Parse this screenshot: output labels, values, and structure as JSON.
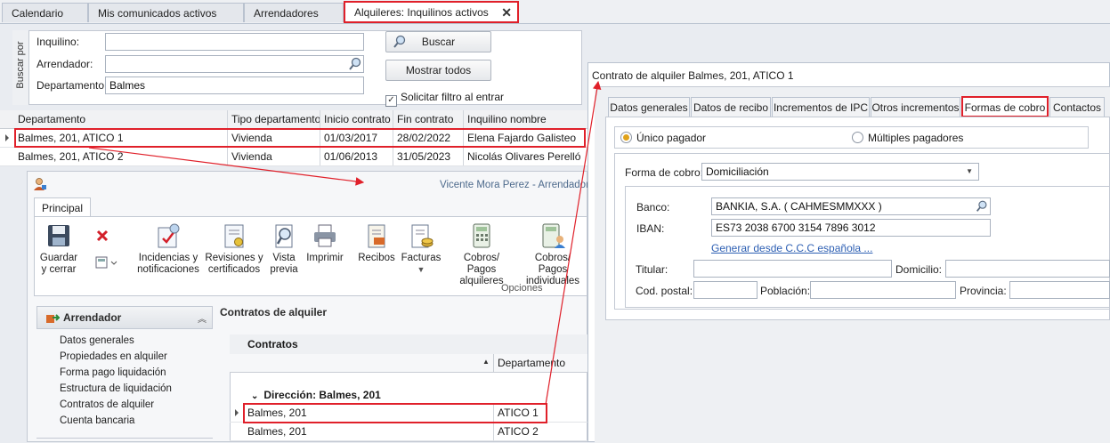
{
  "doc_tabs": [
    {
      "label": "Calendario"
    },
    {
      "label": "Mis comunicados activos"
    },
    {
      "label": "Arrendadores"
    },
    {
      "label": "Alquileres: Inquilinos activos",
      "close": "✕"
    }
  ],
  "search_panel": {
    "side_label": "Buscar por",
    "inquilino_label": "Inquilino:",
    "inquilino_value": "",
    "arrendador_label": "Arrendador:",
    "arrendador_value": "",
    "departamento_label": "Departamento:",
    "departamento_value": "Balmes",
    "buscar_label": "Buscar",
    "mostrar_todos_label": "Mostrar todos",
    "solicitar_label": "Solicitar filtro al entrar",
    "solicitar_checked": true
  },
  "tenants_grid": {
    "columns": [
      "Departamento",
      "Tipo departamento",
      "Inicio contrato",
      "Fin contrato",
      "Inquilino nombre"
    ],
    "rows": [
      [
        "Balmes, 201, ATICO 1",
        "Vivienda",
        "01/03/2017",
        "28/02/2022",
        "Elena Fajardo Galisteo"
      ],
      [
        "Balmes, 201, ATICO 2",
        "Vivienda",
        "01/06/2013",
        "31/05/2023",
        "Nicolás Olivares Perelló"
      ]
    ]
  },
  "landlord_window": {
    "title": "Vicente Mora Perez - Arrendador",
    "ribbon_tab": "Principal",
    "ribbon_buttons": {
      "guardar": "Guardar y cerrar",
      "incidencias": "Incidencias y notificaciones",
      "revisiones": "Revisiones y certificados",
      "vista": "Vista previa",
      "imprimir": "Imprimir",
      "recibos": "Recibos",
      "facturas": "Facturas",
      "cobros_alq": "Cobros/ Pagos alquileres",
      "cobros_ind": "Cobros/ Pagos individuales"
    },
    "ribbon_group": "Opciones",
    "nav_header": "Arrendador",
    "nav_items": [
      "Datos generales",
      "Propiedades en alquiler",
      "Forma pago liquidación",
      "Estructura de liquidación",
      "Contratos de alquiler",
      "Cuenta bancaria"
    ],
    "contracts_title": "Contratos de alquiler",
    "contracts_group": "Contratos",
    "dept_col": "Departamento",
    "group_row": "Dirección: Balmes, 201",
    "rows": [
      {
        "address": "Balmes, 201",
        "dept": "ATICO 1"
      },
      {
        "address": "Balmes, 201",
        "dept": "ATICO 2"
      }
    ]
  },
  "contract_window": {
    "title": "Contrato de alquiler Balmes, 201, ATICO 1",
    "tabs": [
      "Datos generales",
      "Datos de recibo",
      "Incrementos de IPC",
      "Otros incrementos",
      "Formas de cobro",
      "Contactos"
    ],
    "unico": "Único pagador",
    "multiples": "Múltiples pagadores",
    "forma_label": "Forma de cobro:",
    "forma_value": "Domiciliación",
    "banco_label": "Banco:",
    "banco_value": "BANKIA, S.A. ( CAHMESMMXXX )",
    "iban_label": "IBAN:",
    "iban_value": "ES73 2038 6700 3154 7896 3012",
    "generar_link": "Generar desde C.C.C española ...",
    "titular_label": "Titular:",
    "domicilio_label": "Domicilio:",
    "cp_label": "Cod. postal:",
    "poblacion_label": "Población:",
    "provincia_label": "Provincia:"
  },
  "colors": {
    "accent_red": "#e0202a",
    "link_blue": "#2d5fb3",
    "radio_orange": "#e0a21a"
  }
}
